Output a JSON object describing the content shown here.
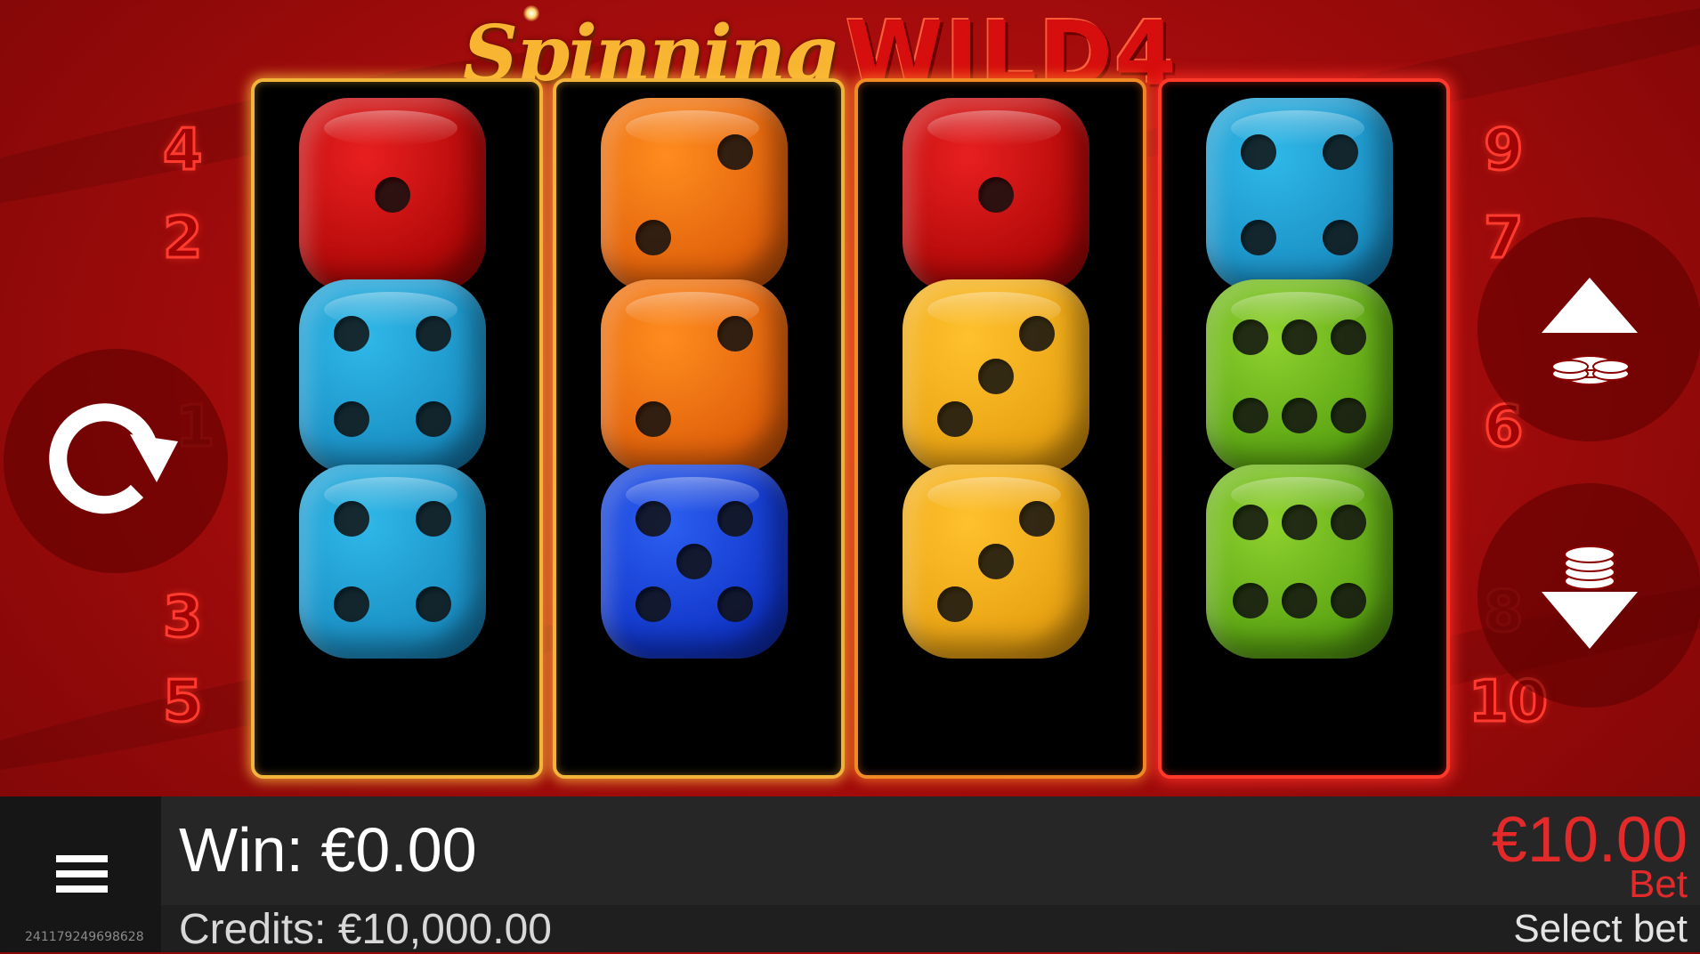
{
  "logo": {
    "part1": "Spinning",
    "part2": "WILD4"
  },
  "paylines": {
    "left": [
      "4",
      "2",
      "1",
      "3",
      "5"
    ],
    "right": [
      "9",
      "7",
      "6",
      "8",
      "10"
    ]
  },
  "reels": [
    {
      "dice": [
        {
          "color": "red",
          "value": 1
        },
        {
          "color": "lightblue",
          "value": 4
        },
        {
          "color": "lightblue",
          "value": 4
        }
      ]
    },
    {
      "dice": [
        {
          "color": "orange",
          "value": 2
        },
        {
          "color": "orange",
          "value": 2
        },
        {
          "color": "blue",
          "value": 5
        }
      ]
    },
    {
      "dice": [
        {
          "color": "red",
          "value": 1
        },
        {
          "color": "yellow",
          "value": 3
        },
        {
          "color": "yellow",
          "value": 3
        }
      ]
    },
    {
      "dice": [
        {
          "color": "lightblue",
          "value": 4
        },
        {
          "color": "green",
          "value": 6
        },
        {
          "color": "green",
          "value": 6
        }
      ]
    }
  ],
  "controls": {
    "spin_icon": "spin-arrow-icon",
    "bet_up_icon": "bet-up-icon",
    "bet_down_icon": "bet-down-icon",
    "menu_icon": "hamburger-menu-icon"
  },
  "status": {
    "win_label": "Win:",
    "win_value": "€0.00",
    "credits_label": "Credits:",
    "credits_value": "€10,000.00",
    "bet_value": "€10.00",
    "bet_label": "Bet",
    "select_bet": "Select bet",
    "session_id": "241179249698628"
  },
  "colors": {
    "bet_red": "#e22a2a",
    "background_red": "#b00c0c",
    "logo_gold": "#f7b531"
  }
}
